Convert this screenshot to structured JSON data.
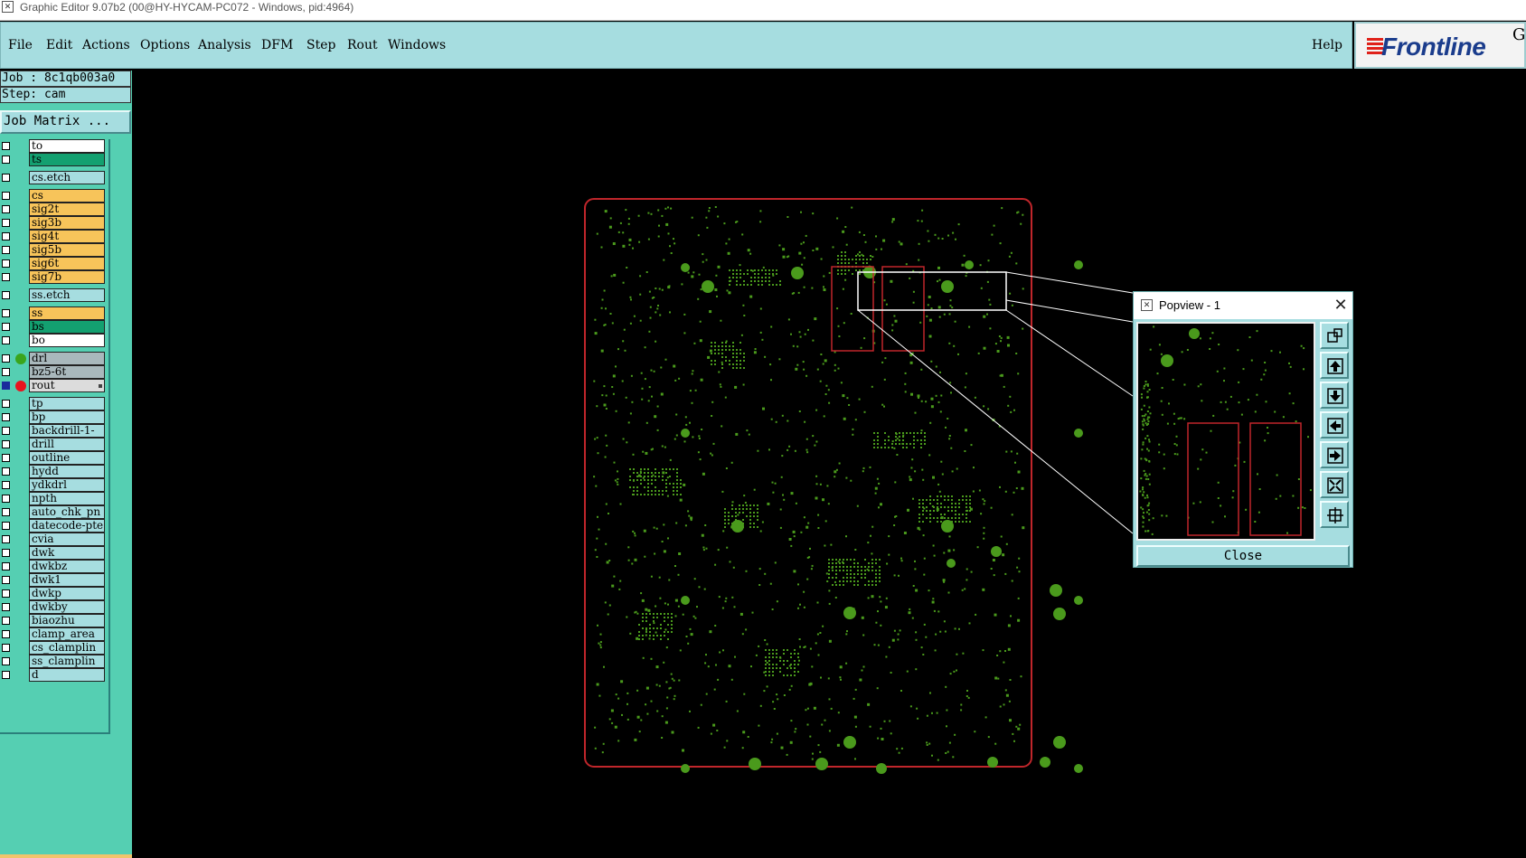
{
  "window": {
    "title": "Graphic Editor 9.07b2 (00@HY-HYCAM-PC072 - Windows, pid:4964)"
  },
  "menu": {
    "items": [
      "File",
      "Edit",
      "Actions",
      "Options",
      "Analysis",
      "DFM",
      "Step",
      "Rout",
      "Windows"
    ],
    "help": "Help"
  },
  "logo": {
    "text": "Frontline",
    "corner": "G"
  },
  "job": {
    "job_line": "Job : 8c1qb003a0",
    "step_line": "Step: cam",
    "matrix_button": "Job Matrix ..."
  },
  "colors": {
    "accent": "#a6dde0",
    "panel": "#55cfb2",
    "board_features": "#4a9a1c",
    "profile": "#c0262b"
  },
  "layers": [
    {
      "name": "to",
      "color": "#ffffff",
      "gap": false,
      "checked": false,
      "dot": null
    },
    {
      "name": "ts",
      "color": "#13a070",
      "gap": false,
      "checked": false,
      "dot": null
    },
    {
      "name": "cs.etch",
      "color": "#a6dde0",
      "gap": true,
      "checked": false,
      "dot": null
    },
    {
      "name": "cs",
      "color": "#f7c45a",
      "gap": true,
      "checked": false,
      "dot": null
    },
    {
      "name": "sig2t",
      "color": "#f7c45a",
      "gap": false,
      "checked": false,
      "dot": null
    },
    {
      "name": "sig3b",
      "color": "#f7c45a",
      "gap": false,
      "checked": false,
      "dot": null
    },
    {
      "name": "sig4t",
      "color": "#f7c45a",
      "gap": false,
      "checked": false,
      "dot": null
    },
    {
      "name": "sig5b",
      "color": "#f7c45a",
      "gap": false,
      "checked": false,
      "dot": null
    },
    {
      "name": "sig6t",
      "color": "#f7c45a",
      "gap": false,
      "checked": false,
      "dot": null
    },
    {
      "name": "sig7b",
      "color": "#f7c45a",
      "gap": false,
      "checked": false,
      "dot": null
    },
    {
      "name": "ss.etch",
      "color": "#a6dde0",
      "gap": true,
      "checked": false,
      "dot": null
    },
    {
      "name": "ss",
      "color": "#f7c45a",
      "gap": true,
      "checked": false,
      "dot": null
    },
    {
      "name": "bs",
      "color": "#13a070",
      "gap": false,
      "checked": false,
      "dot": null
    },
    {
      "name": "bo",
      "color": "#ffffff",
      "gap": false,
      "checked": false,
      "dot": null
    },
    {
      "name": "drl",
      "color": "#a9b8bc",
      "gap": true,
      "checked": false,
      "dot": "#3aa51c"
    },
    {
      "name": "bz5-6t",
      "color": "#a9b8bc",
      "gap": false,
      "checked": false,
      "dot": null
    },
    {
      "name": "rout",
      "color": "#dcdcdc",
      "gap": false,
      "checked": true,
      "dot": "#e8141e",
      "marker": true
    },
    {
      "name": "tp",
      "color": "#a6dde0",
      "gap": true,
      "checked": false,
      "dot": null
    },
    {
      "name": "bp",
      "color": "#a6dde0",
      "gap": false,
      "checked": false,
      "dot": null
    },
    {
      "name": "backdrill-1-",
      "color": "#a6dde0",
      "gap": false,
      "checked": false,
      "dot": null
    },
    {
      "name": "drill",
      "color": "#a6dde0",
      "gap": false,
      "checked": false,
      "dot": null
    },
    {
      "name": "outline",
      "color": "#a6dde0",
      "gap": false,
      "checked": false,
      "dot": null
    },
    {
      "name": "hydd",
      "color": "#a6dde0",
      "gap": false,
      "checked": false,
      "dot": null
    },
    {
      "name": "ydkdrl",
      "color": "#a6dde0",
      "gap": false,
      "checked": false,
      "dot": null
    },
    {
      "name": "npth",
      "color": "#a6dde0",
      "gap": false,
      "checked": false,
      "dot": null
    },
    {
      "name": "auto_chk_pn",
      "color": "#a6dde0",
      "gap": false,
      "checked": false,
      "dot": null
    },
    {
      "name": "datecode-pte",
      "color": "#a6dde0",
      "gap": false,
      "checked": false,
      "dot": null
    },
    {
      "name": "cvia",
      "color": "#a6dde0",
      "gap": false,
      "checked": false,
      "dot": null
    },
    {
      "name": "dwk",
      "color": "#a6dde0",
      "gap": false,
      "checked": false,
      "dot": null
    },
    {
      "name": "dwkbz",
      "color": "#a6dde0",
      "gap": false,
      "checked": false,
      "dot": null
    },
    {
      "name": "dwk1",
      "color": "#a6dde0",
      "gap": false,
      "checked": false,
      "dot": null
    },
    {
      "name": "dwkp",
      "color": "#a6dde0",
      "gap": false,
      "checked": false,
      "dot": null
    },
    {
      "name": "dwkby",
      "color": "#a6dde0",
      "gap": false,
      "checked": false,
      "dot": null
    },
    {
      "name": "biaozhu",
      "color": "#a6dde0",
      "gap": false,
      "checked": false,
      "dot": null
    },
    {
      "name": "clamp_area",
      "color": "#a6dde0",
      "gap": false,
      "checked": false,
      "dot": null
    },
    {
      "name": "cs_clamplin",
      "color": "#a6dde0",
      "gap": false,
      "checked": false,
      "dot": null
    },
    {
      "name": "ss_clamplin",
      "color": "#a6dde0",
      "gap": false,
      "checked": false,
      "dot": null
    },
    {
      "name": "d",
      "color": "#a6dde0",
      "gap": false,
      "checked": false,
      "dot": null
    }
  ],
  "popview": {
    "title": "Popview - 1",
    "close_label": "Close",
    "buttons": [
      "zoom-window-icon",
      "pan-up-icon",
      "pan-down-icon",
      "pan-left-icon",
      "pan-right-icon",
      "zoom-out-icon",
      "zoom-fit-icon"
    ]
  }
}
